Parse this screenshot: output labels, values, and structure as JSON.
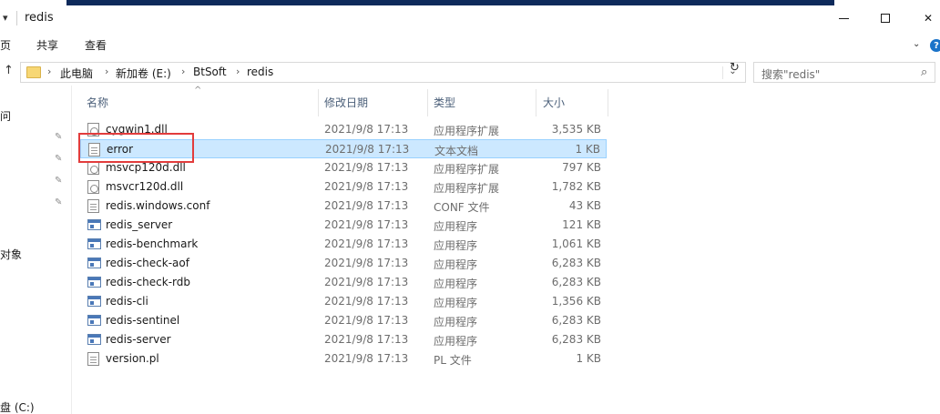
{
  "window": {
    "title": "redis",
    "qa_arrow": "▾",
    "minimize": "",
    "maximize": "",
    "close": "✕"
  },
  "ribbon": {
    "tabs": [
      "页",
      "共享",
      "查看"
    ],
    "expand": "⌄",
    "help": "?"
  },
  "address": {
    "up": "↑",
    "crumbs": [
      "此电脑",
      "新加卷 (E:)",
      "BtSoft",
      "redis"
    ],
    "separator": "›",
    "dropdown": "⌄",
    "refresh": "↻"
  },
  "search": {
    "placeholder": "搜索\"redis\"",
    "icon": "⌕"
  },
  "nav": {
    "items": [
      {
        "label": "问"
      },
      {
        "label": "对象"
      },
      {
        "label": "盘 (C:)"
      }
    ],
    "pin": "✎"
  },
  "columns": {
    "sort_caret": "^",
    "name": "名称",
    "date": "修改日期",
    "type": "类型",
    "size": "大小"
  },
  "files": [
    {
      "name": "cygwin1.dll",
      "date": "2021/9/8 17:13",
      "type": "应用程序扩展",
      "size": "3,535 KB",
      "icon": "dll"
    },
    {
      "name": "error",
      "date": "2021/9/8 17:13",
      "type": "文本文档",
      "size": "1 KB",
      "icon": "doc",
      "selected": true
    },
    {
      "name": "msvcp120d.dll",
      "date": "2021/9/8 17:13",
      "type": "应用程序扩展",
      "size": "797 KB",
      "icon": "dll"
    },
    {
      "name": "msvcr120d.dll",
      "date": "2021/9/8 17:13",
      "type": "应用程序扩展",
      "size": "1,782 KB",
      "icon": "dll"
    },
    {
      "name": "redis.windows.conf",
      "date": "2021/9/8 17:13",
      "type": "CONF 文件",
      "size": "43 KB",
      "icon": "doc"
    },
    {
      "name": "redis_server",
      "date": "2021/9/8 17:13",
      "type": "应用程序",
      "size": "121 KB",
      "icon": "exe"
    },
    {
      "name": "redis-benchmark",
      "date": "2021/9/8 17:13",
      "type": "应用程序",
      "size": "1,061 KB",
      "icon": "exe"
    },
    {
      "name": "redis-check-aof",
      "date": "2021/9/8 17:13",
      "type": "应用程序",
      "size": "6,283 KB",
      "icon": "exe"
    },
    {
      "name": "redis-check-rdb",
      "date": "2021/9/8 17:13",
      "type": "应用程序",
      "size": "6,283 KB",
      "icon": "exe"
    },
    {
      "name": "redis-cli",
      "date": "2021/9/8 17:13",
      "type": "应用程序",
      "size": "1,356 KB",
      "icon": "exe"
    },
    {
      "name": "redis-sentinel",
      "date": "2021/9/8 17:13",
      "type": "应用程序",
      "size": "6,283 KB",
      "icon": "exe"
    },
    {
      "name": "redis-server",
      "date": "2021/9/8 17:13",
      "type": "应用程序",
      "size": "6,283 KB",
      "icon": "exe"
    },
    {
      "name": "version.pl",
      "date": "2021/9/8 17:13",
      "type": "PL 文件",
      "size": "1 KB",
      "icon": "doc"
    }
  ],
  "colors": {
    "selection_bg": "#cce8ff",
    "selection_border": "#99d1ff",
    "highlight": "#e23c3c",
    "title_strip": "#0e2a5b"
  }
}
